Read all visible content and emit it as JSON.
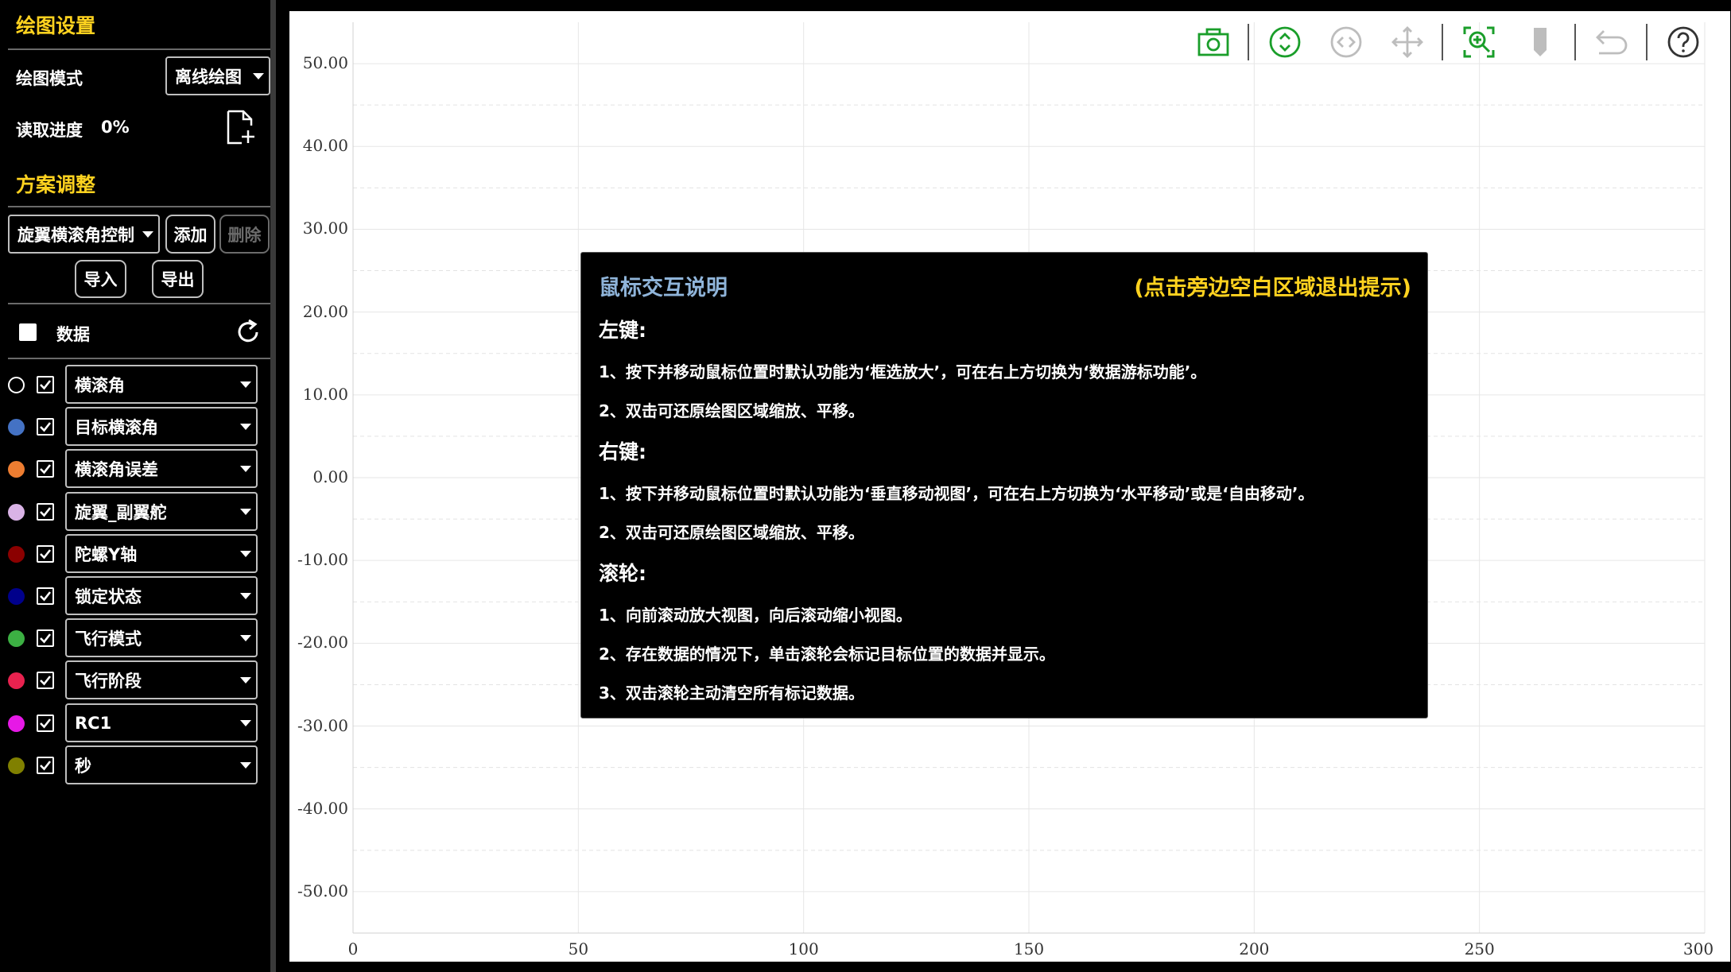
{
  "sidebar": {
    "plot_settings_title": "绘图设置",
    "plot_mode_label": "绘图模式",
    "plot_mode_value": "离线绘图",
    "read_progress_label": "读取进度",
    "read_progress_value": "0%",
    "scheme_title": "方案调整",
    "scheme_value": "旋翼横滚角控制",
    "add_label": "添加",
    "delete_label": "删除",
    "import_label": "导入",
    "export_label": "导出",
    "data_label": "数据",
    "series": [
      {
        "name": "横滚角",
        "color": "#000000",
        "checked": true
      },
      {
        "name": "目标横滚角",
        "color": "#4472c4",
        "checked": true
      },
      {
        "name": "横滚角误差",
        "color": "#ed7d31",
        "checked": true
      },
      {
        "name": "旋翼_副翼舵",
        "color": "#d9b3e6",
        "checked": true
      },
      {
        "name": "陀螺Y轴",
        "color": "#8b0000",
        "checked": true
      },
      {
        "name": "锁定状态",
        "color": "#00008b",
        "checked": true
      },
      {
        "name": "飞行模式",
        "color": "#3cb043",
        "checked": true
      },
      {
        "name": "飞行阶段",
        "color": "#e8224f",
        "checked": true
      },
      {
        "name": "RC1",
        "color": "#e619e6",
        "checked": true
      },
      {
        "name": "秒",
        "color": "#808000",
        "checked": true
      }
    ]
  },
  "chart_data": {
    "type": "line",
    "x_ticks": [
      "0",
      "50",
      "100",
      "150",
      "200",
      "250",
      "300"
    ],
    "y_ticks": [
      "50.00",
      "40.00",
      "30.00",
      "20.00",
      "10.00",
      "0.00",
      "-10.00",
      "-20.00",
      "-30.00",
      "-40.00",
      "-50.00"
    ],
    "xlim": [
      0,
      300
    ],
    "ylim": [
      -55,
      55
    ],
    "grid": true,
    "series": []
  },
  "toolbar": {
    "icons": [
      "camera-icon",
      "vertical-move-icon",
      "horizontal-move-icon",
      "free-move-icon",
      "zoom-select-icon",
      "marker-icon",
      "undo-icon",
      "help-icon"
    ]
  },
  "help": {
    "title": "鼠标交互说明",
    "exit_hint": "(点击旁边空白区域退出提示)",
    "left_title": "左键:",
    "left_1": "1、按下并移动鼠标位置时默认功能为‘框选放大’，可在右上方切换为‘数据游标功能’。",
    "left_2": "2、双击可还原绘图区域缩放、平移。",
    "right_title": "右键:",
    "right_1": "1、按下并移动鼠标位置时默认功能为‘垂直移动视图’，可在右上方切换为‘水平移动’或是‘自由移动’。",
    "right_2": "2、双击可还原绘图区域缩放、平移。",
    "wheel_title": "滚轮:",
    "wheel_1": "1、向前滚动放大视图，向后滚动缩小视图。",
    "wheel_2": "2、存在数据的情况下，单击滚轮会标记目标位置的数据并显示。",
    "wheel_3": "3、双击滚轮主动清空所有标记数据。"
  },
  "colors": {
    "accent_yellow": "#ffd21f",
    "tool_green": "#1a9e2a",
    "tool_gray": "#bdbdbd"
  }
}
